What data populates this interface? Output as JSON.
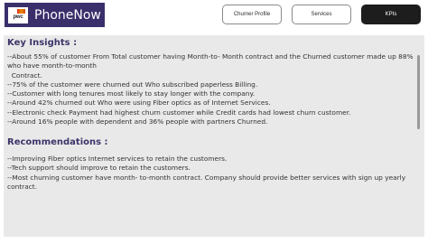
{
  "brand": {
    "logo_text": "pwc",
    "name": "PhoneNow"
  },
  "nav": {
    "churner_profile": "Churner Profile",
    "services": "Services",
    "kpis": "KPIs"
  },
  "insights": {
    "title": "Key Insights :",
    "lines": [
      "--About 55% of customer From Total customer having Month-to- Month contract and the Churned customer made up 88% who have month-to-month\n  Contract.",
      "--75% of the customer were churned out Who subscribed paperless Billing.",
      "--Customer with long tenures most likely to stay longer with the company.",
      "--Around 42% churned out Who were using Fiber optics as of Internet Services.",
      "--Electronic check Payment had highest churn customer while Credit cards had lowest churn customer.",
      "--Around 16% people with dependent and 36% people with partners Churned."
    ]
  },
  "recommendations": {
    "title": "Recommendations :",
    "lines": [
      "--Improving Fiber optics Internet services to retain the customers.",
      "--Tech support should improve to retain the customers.",
      "--Most churning customer have month- to-month contract. Company should provide better services with sign up yearly contract."
    ]
  }
}
